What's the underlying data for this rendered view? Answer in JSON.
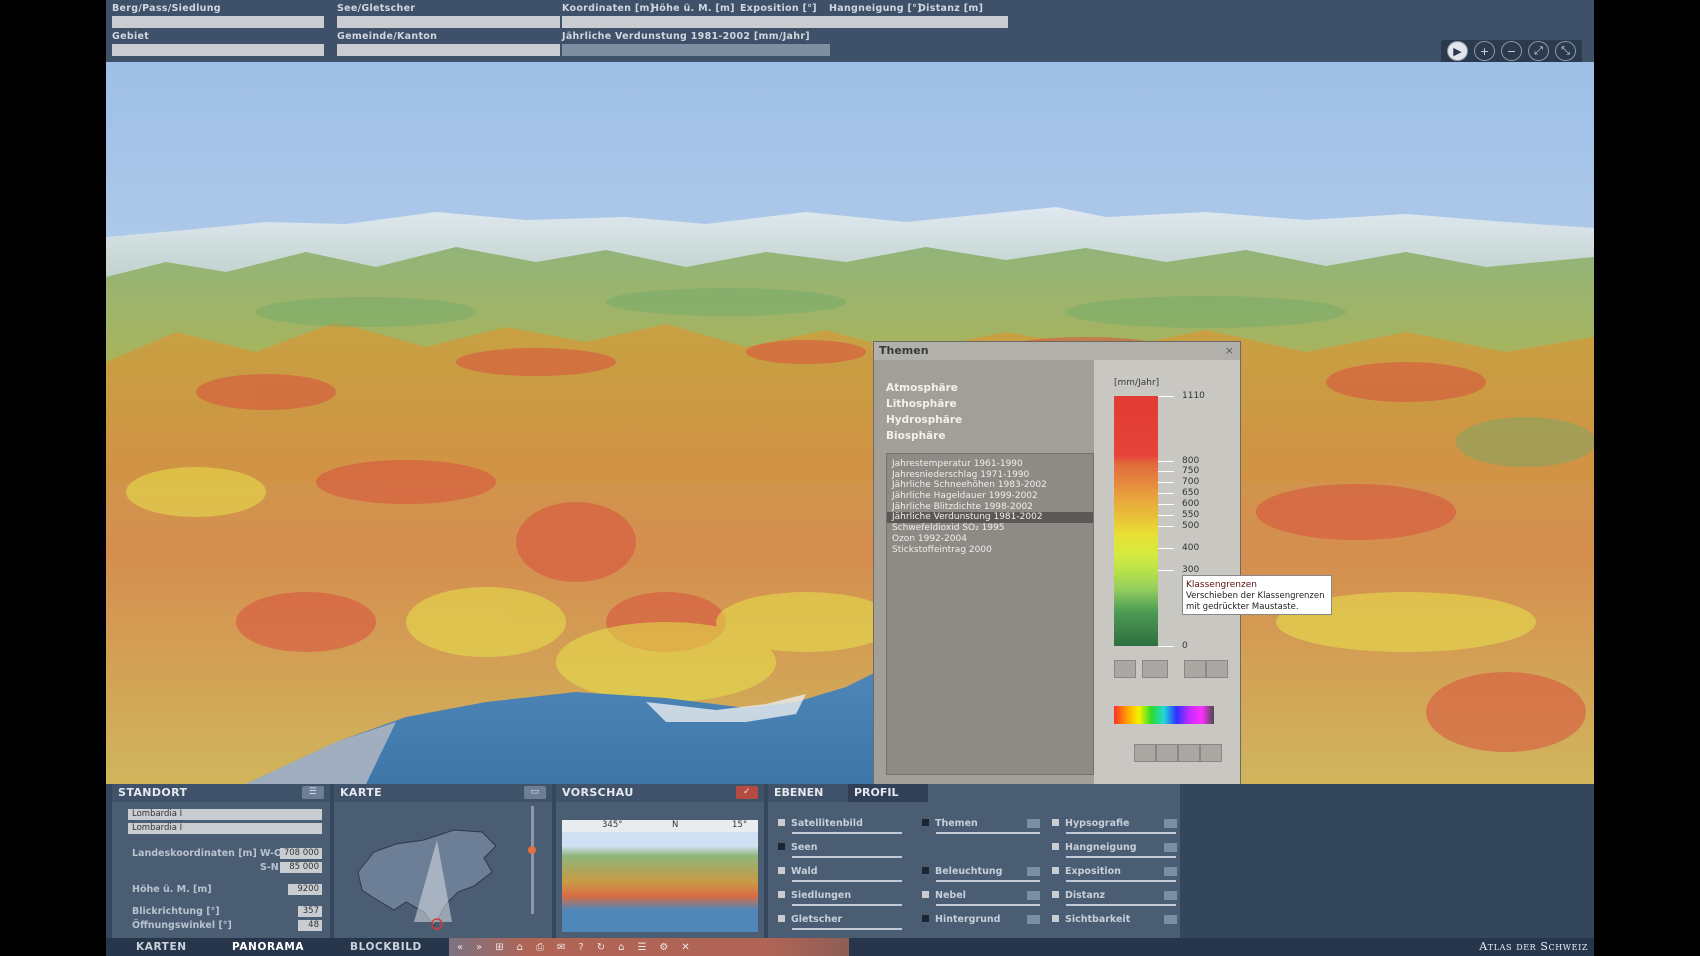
{
  "infobar": {
    "row1": [
      {
        "label": "Berg/Pass/Siedlung",
        "value": ""
      },
      {
        "label": "See/Gletscher",
        "value": ""
      },
      {
        "label": "Koordinaten [m]",
        "value": ""
      },
      {
        "label": "Höhe ü. M. [m]",
        "value": ""
      },
      {
        "label": "Exposition [°]",
        "value": ""
      },
      {
        "label": "Hangneigung [°]",
        "value": ""
      },
      {
        "label": "Distanz [m]",
        "value": ""
      }
    ],
    "row2": [
      {
        "label": "Gebiet",
        "value": ""
      },
      {
        "label": "Gemeinde/Kanton",
        "value": ""
      },
      {
        "label": "Jährliche Verdunstung 1981-2002 [mm/Jahr]",
        "value": ""
      }
    ]
  },
  "nav": {
    "play": "▶",
    "zoom_in": "+",
    "zoom_out": "−",
    "icon3": "⤢",
    "icon4": "⤡"
  },
  "themen": {
    "title": "Themen",
    "close": "×",
    "spheres": [
      "Atmosphäre",
      "Lithosphäre",
      "Hydrosphäre",
      "Biosphäre"
    ],
    "items": [
      "Jahrestemperatur 1961-1990",
      "Jahresniederschlag 1971-1990",
      "Jährliche Schneehöhen 1983-2002",
      "Jährliche Hageldauer 1999-2002",
      "Jährliche Blitzdichte 1998-2002",
      "Jährliche Verdunstung 1981-2002",
      "Schwefeldioxid SO₂ 1995",
      "Ozon 1992-2004",
      "Stickstoffeintrag 2000"
    ],
    "selected_index": 5,
    "legend": {
      "unit": "[mm/Jahr]",
      "ticks": [
        "1110",
        "800",
        "750",
        "700",
        "650",
        "600",
        "550",
        "500",
        "400",
        "300",
        "0"
      ]
    }
  },
  "tooltip": {
    "title": "Klassengrenzen",
    "text": "Verschieben der Klassengrenzen mit gedrückter Maustaste."
  },
  "standort": {
    "title": "STANDORT",
    "icon": "list-icon",
    "sel1": "Lombardia  I",
    "sel2": "Lombardia  I",
    "coords_label": "Landeskoordinaten [m]",
    "wo_label": "W-O",
    "wo": "708 000",
    "sn_label": "S-N",
    "sn": "85 000",
    "height_label": "Höhe ü. M. [m]",
    "height": "9200",
    "dir_label": "Blickrichtung [°]",
    "dir": "357",
    "angle_label": "Öffnungswinkel [°]",
    "angle": "48"
  },
  "karte": {
    "title": "KARTE",
    "icon": "map-icon"
  },
  "vorschau": {
    "title": "VORSCHAU",
    "check": "✓",
    "left": "345°",
    "mid": "N",
    "right": "15°"
  },
  "ebenen": {
    "tabs": [
      "EBENEN",
      "PROFIL"
    ],
    "col1": [
      {
        "label": "Satellitenbild",
        "checked": false
      },
      {
        "label": "Seen",
        "checked": true
      },
      {
        "label": "Wald",
        "checked": false
      },
      {
        "label": "Siedlungen",
        "checked": false
      },
      {
        "label": "Gletscher",
        "checked": false
      }
    ],
    "col2": [
      {
        "label": "Themen",
        "checked": true
      },
      {
        "label": "Beleuchtung",
        "checked": true
      },
      {
        "label": "Nebel",
        "checked": false
      },
      {
        "label": "Hintergrund",
        "checked": true
      }
    ],
    "col3": [
      {
        "label": "Hypsografie",
        "checked": false
      },
      {
        "label": "Hangneigung",
        "checked": false
      },
      {
        "label": "Exposition",
        "checked": false
      },
      {
        "label": "Distanz",
        "checked": false
      },
      {
        "label": "Sichtbarkeit",
        "checked": false
      }
    ]
  },
  "footer": {
    "tabs": [
      "KARTEN",
      "PANORAMA",
      "BLOCKBILD"
    ],
    "active": "PANORAMA",
    "tools": [
      "«",
      "»",
      "⊞",
      "⌂",
      "⎙",
      "✉",
      "?",
      "↻",
      "⌂",
      "☰",
      "⚙",
      "✕"
    ],
    "brand": "Atlas der Schweiz"
  }
}
